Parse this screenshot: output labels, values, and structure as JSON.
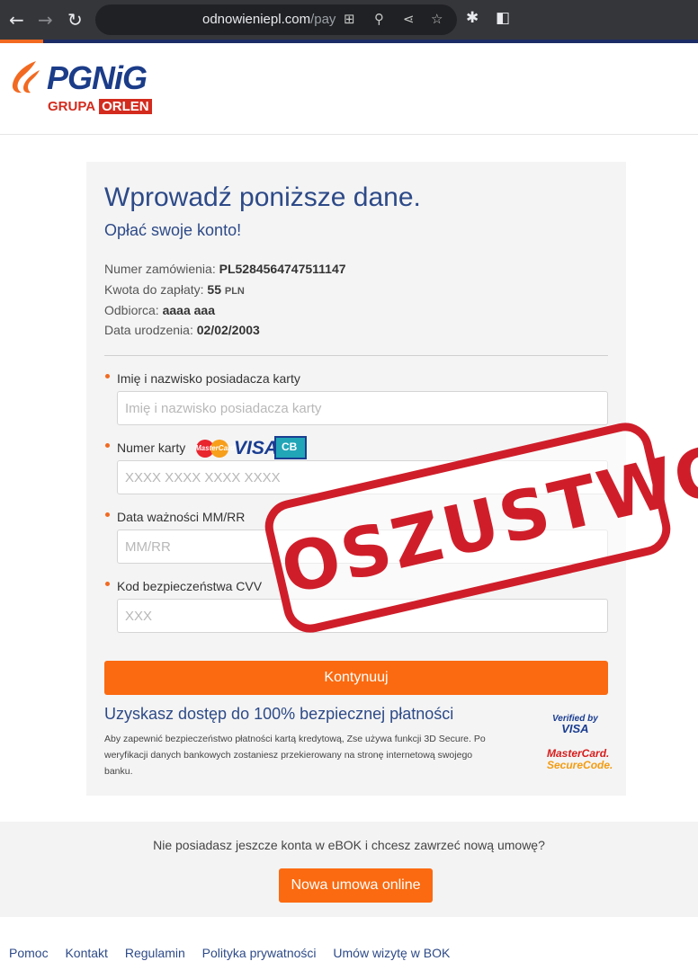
{
  "browser": {
    "url_domain": "odnowieniepl.com",
    "url_path": "/pay"
  },
  "header": {
    "logo_text": "PGNiG",
    "logo_sub_prefix": "GRUPA",
    "logo_sub_box": "ORLEN"
  },
  "form": {
    "title": "Wprowadź poniższe dane.",
    "subtitle": "Opłać swoje konto!",
    "info": [
      {
        "label": "Numer zamówienia:",
        "value": "PL5284564747511147",
        "unit": ""
      },
      {
        "label": "Kwota do zapłaty:",
        "value": "55",
        "unit": "PLN"
      },
      {
        "label": "Odbiorca:",
        "value": "aaaa aaa",
        "unit": ""
      },
      {
        "label": "Data urodzenia:",
        "value": "02/02/2003",
        "unit": ""
      }
    ],
    "fields": {
      "name": {
        "label": "Imię i nazwisko posiadacza karty",
        "placeholder": "Imię i nazwisko posiadacza karty"
      },
      "card": {
        "label": "Numer karty",
        "placeholder": "XXXX XXXX XXXX XXXX"
      },
      "expiry": {
        "label": "Data ważności MM/RR",
        "placeholder": "MM/RR"
      },
      "cvv": {
        "label": "Kod bezpieczeństwa CVV",
        "placeholder": "XXX"
      }
    },
    "card_logos": {
      "mastercard": "MasterCard",
      "visa": "VISA",
      "cb": "CB"
    },
    "submit_label": "Kontynuuj",
    "secure_title": "Uzyskasz dostęp do 100% bezpiecznej płatności",
    "secure_text": "Aby zapewnić bezpieczeństwo płatności kartą kredytową, Zse używa funkcji 3D Secure. Po weryfikacji danych bankowych zostaniesz przekierowany na stronę internetową swojego banku.",
    "badges": {
      "vbv_top": "Verified by",
      "vbv_bottom": "VISA",
      "mc_top": "MasterCard.",
      "mc_bottom": "SecureCode."
    }
  },
  "stamp_text": "OSZUSTWO",
  "band": {
    "text": "Nie posiadasz jeszcze konta w eBOK i chcesz zawrzeć nową umowę?",
    "button": "Nowa umowa online"
  },
  "footer": {
    "links": [
      "Pomoc",
      "Kontakt",
      "Regulamin",
      "Polityka prywatności",
      "Umów wizytę w BOK"
    ]
  },
  "colors": {
    "brand_blue": "#2d4a88",
    "accent_orange": "#fb6a10",
    "stamp_red": "#cf1e2a"
  }
}
